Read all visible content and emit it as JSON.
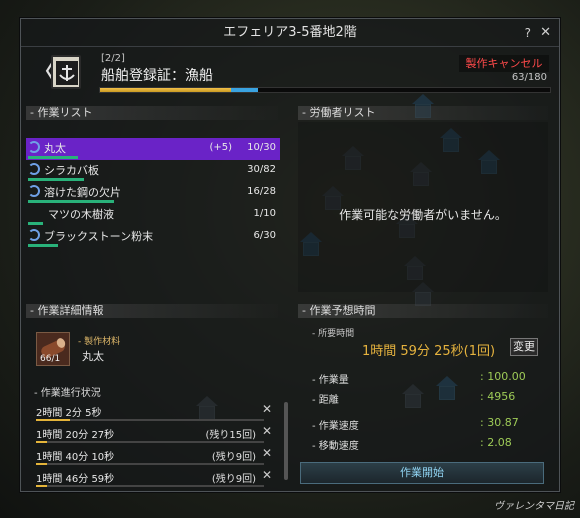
{
  "window": {
    "title": "エフェリア3-5番地2階",
    "help_icon": "?",
    "close_icon": "✕"
  },
  "quest": {
    "count": "[2/2]",
    "name": "船舶登録証：漁船",
    "cancel_label": "製作キャンセル",
    "progress_text": "63/180",
    "progress_fraction": 0.35
  },
  "work_list": {
    "title": "作業リスト",
    "items": [
      {
        "name": "丸太",
        "bonus": "(+5)",
        "count": "10/30",
        "fraction": 0.33,
        "spin": true,
        "selected": true
      },
      {
        "name": "シラカバ板",
        "bonus": "",
        "count": "30/82",
        "fraction": 0.37,
        "spin": true,
        "selected": false
      },
      {
        "name": "溶けた鋼の欠片",
        "bonus": "",
        "count": "16/28",
        "fraction": 0.57,
        "spin": true,
        "selected": false
      },
      {
        "name": "マツの木樹液",
        "bonus": "",
        "count": "1/10",
        "fraction": 0.1,
        "spin": false,
        "selected": false
      },
      {
        "name": "ブラックストーン粉末",
        "bonus": "",
        "count": "6/30",
        "fraction": 0.2,
        "spin": true,
        "selected": false
      }
    ]
  },
  "worker_list": {
    "title": "労働者リスト",
    "empty_text": "作業可能な労働者がいません。"
  },
  "detail": {
    "title": "作業詳細情報",
    "material_label": "- 製作材料",
    "material_qty": "66/1",
    "material_name": "丸太",
    "progress_title": "- 作業進行状況",
    "rows": [
      {
        "time": "2時間 2分 5秒",
        "left": "",
        "fraction": 0.15
      },
      {
        "time": "1時間 20分 27秒",
        "left": "(残り15回)",
        "fraction": 0.05
      },
      {
        "time": "1時間 40分 10秒",
        "left": "(残り9回)",
        "fraction": 0.05
      },
      {
        "time": "1時間 46分 59秒",
        "left": "(残り9回)",
        "fraction": 0.05
      }
    ],
    "remove_icon": "✕"
  },
  "estimate": {
    "title": "作業予想時間",
    "required_label": "- 所要時間",
    "required_value": "1時間 59分 25秒(1回)",
    "change_label": "変更",
    "stats": [
      {
        "key": "- 作業量",
        "value": ": 100.00"
      },
      {
        "key": "- 距離",
        "value": ": 4956"
      },
      {
        "key": "- 作業速度",
        "value": ": 30.87"
      },
      {
        "key": "- 移動速度",
        "value": ": 2.08"
      }
    ],
    "start_label": "作業開始"
  },
  "watermark": "ヴァレンタマ日記",
  "colors": {
    "accent_purple": "#6a23c7",
    "value_green": "#9ecb57",
    "time_gold": "#e6b33e",
    "cancel_red": "#ff4a4a"
  }
}
